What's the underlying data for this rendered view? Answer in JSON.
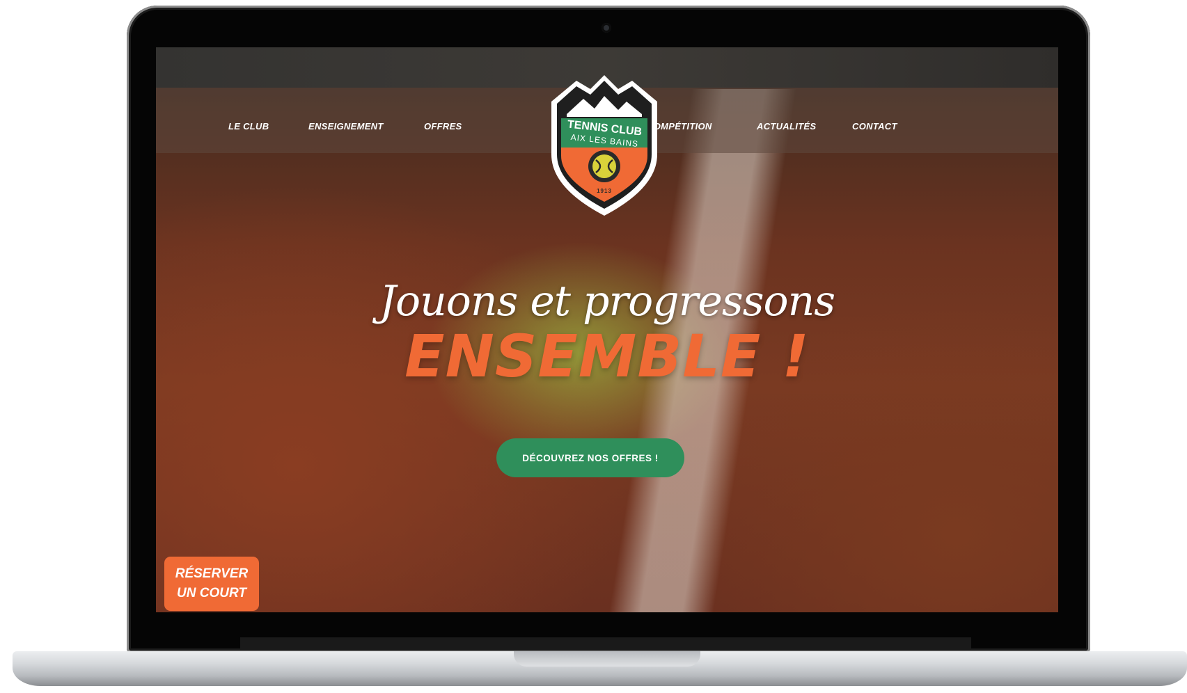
{
  "nav": {
    "items_left": [
      "LE CLUB",
      "ENSEIGNEMENT",
      "OFFRES"
    ],
    "items_right": [
      "COMPÉTITION",
      "ACTUALITÉS",
      "CONTACT"
    ]
  },
  "logo": {
    "line1": "TENNIS CLUB",
    "line2": "AIX LES BAINS",
    "year": "1913",
    "icon": "mountain-tennis-ball-crest"
  },
  "hero": {
    "script_text": "Jouons et progressons",
    "big_text": "ENSEMBLE !",
    "cta_label": "DÉCOUVREZ NOS OFFRES !"
  },
  "reserve": {
    "line1": "RÉSERVER",
    "line2": "UN COURT"
  },
  "colors": {
    "accent_orange": "#f06a35",
    "accent_green": "#2f8f5b",
    "clay": "#7a3a22"
  }
}
